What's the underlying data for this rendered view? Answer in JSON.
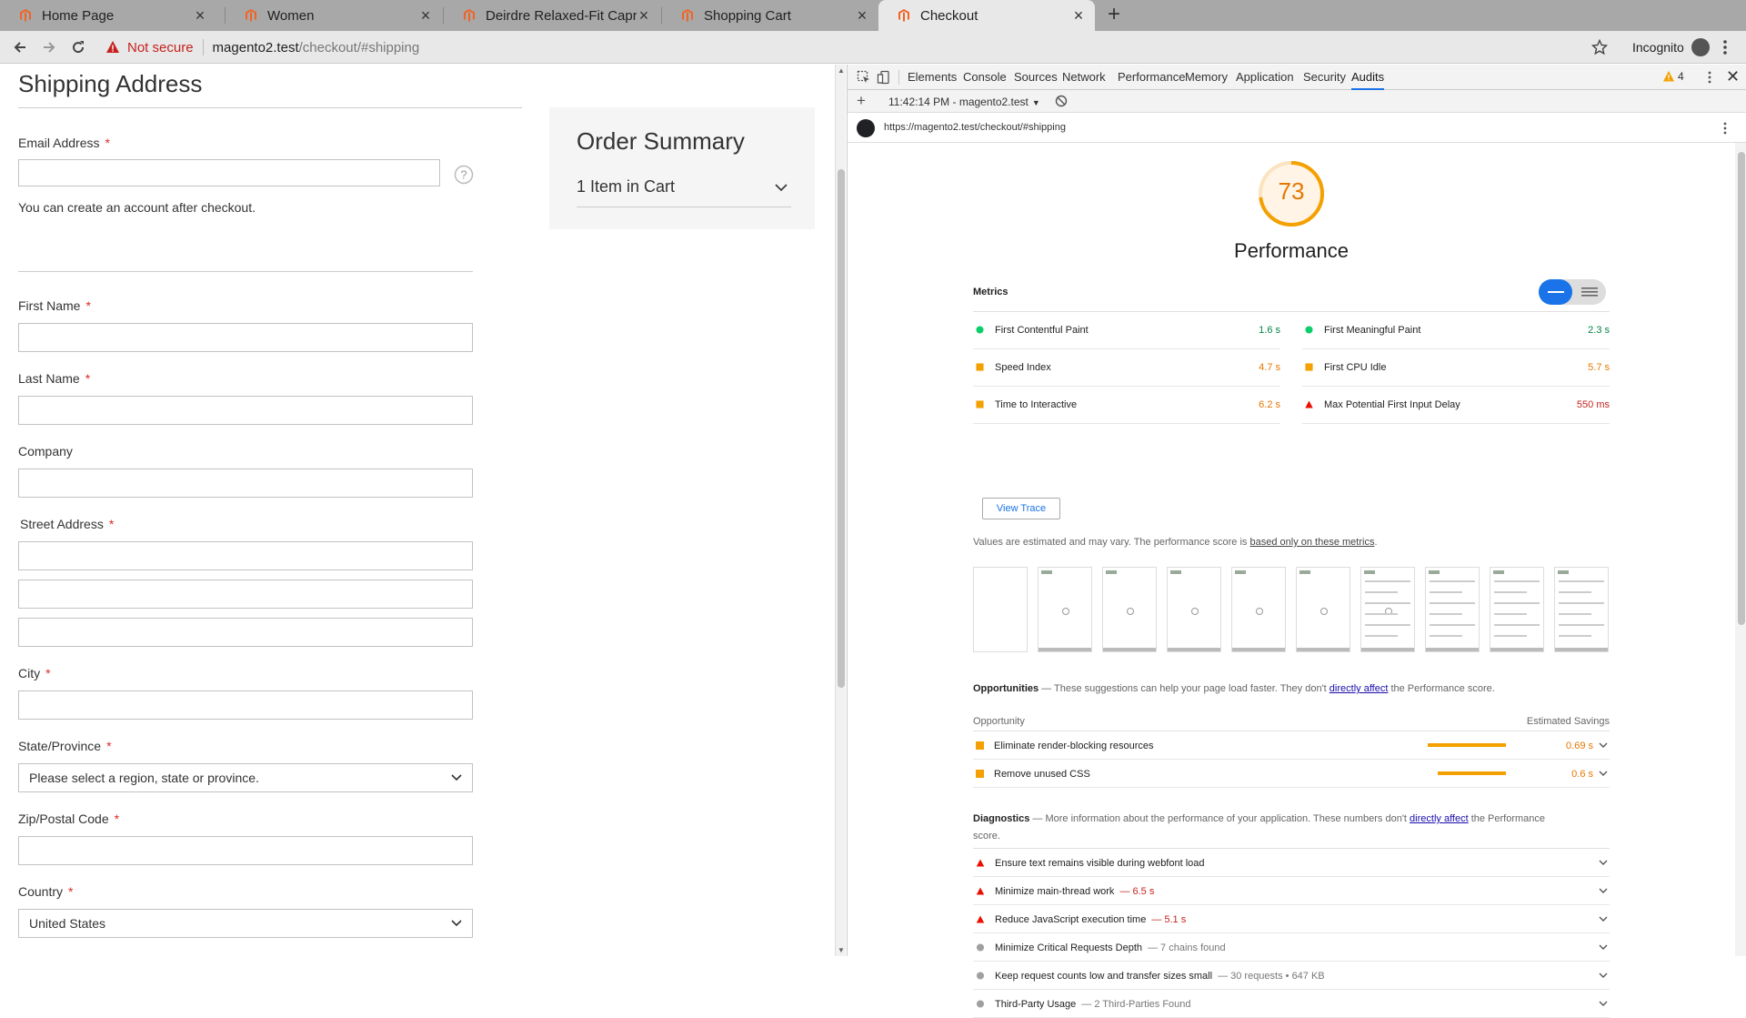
{
  "browser": {
    "tabs": [
      {
        "title": "Home Page"
      },
      {
        "title": "Women"
      },
      {
        "title": "Deirdre Relaxed-Fit Capri"
      },
      {
        "title": "Shopping Cart"
      },
      {
        "title": "Checkout",
        "active": true
      }
    ],
    "security_label": "Not secure",
    "url_host": "magento2.test",
    "url_path": "/checkout/#shipping",
    "profile_label": "Incognito"
  },
  "page": {
    "title": "Shipping Address",
    "email_label": "Email Address",
    "account_note": "You can create an account after checkout.",
    "first_name_label": "First Name",
    "last_name_label": "Last Name",
    "company_label": "Company",
    "street_label": "Street Address",
    "city_label": "City",
    "state_label": "State/Province",
    "state_value": "Please select a region, state or province.",
    "zip_label": "Zip/Postal Code",
    "country_label": "Country",
    "country_value": "United States",
    "required_mark": "*"
  },
  "order_summary": {
    "title": "Order Summary",
    "items": "1 Item in Cart"
  },
  "devtools": {
    "tabs": [
      "Elements",
      "Console",
      "Sources",
      "Network",
      "Performance",
      "Memory",
      "Application",
      "Security",
      "Audits"
    ],
    "active_tab": "Audits",
    "warning_count": "4",
    "report_label": "11:42:14 PM - magento2.test",
    "url": "https://magento2.test/checkout/#shipping"
  },
  "audit": {
    "score": "73",
    "score_value": 73,
    "category": "Performance",
    "metrics_heading": "Metrics",
    "metrics": [
      {
        "name": "First Contentful Paint",
        "value": "1.6 s",
        "status": "pass"
      },
      {
        "name": "First Meaningful Paint",
        "value": "2.3 s",
        "status": "pass"
      },
      {
        "name": "Speed Index",
        "value": "4.7 s",
        "status": "average"
      },
      {
        "name": "First CPU Idle",
        "value": "5.7 s",
        "status": "average"
      },
      {
        "name": "Time to Interactive",
        "value": "6.2 s",
        "status": "average"
      },
      {
        "name": "Max Potential First Input Delay",
        "value": "550 ms",
        "status": "fail"
      }
    ],
    "view_trace": "View Trace",
    "estimate_text": "Values are estimated and may vary. The performance score is ",
    "estimate_link": "based only on these metrics",
    "estimate_end": ".",
    "opportunities": {
      "heading": "Opportunities",
      "text": " — These suggestions can help your page load faster. They don't ",
      "link": "directly affect",
      "text_end": " the Performance score.",
      "col_left": "Opportunity",
      "col_right": "Estimated Savings",
      "items": [
        {
          "name": "Eliminate render-blocking resources",
          "value": "0.69 s",
          "savings": 0.69
        },
        {
          "name": "Remove unused CSS",
          "value": "0.6 s",
          "savings": 0.6
        }
      ]
    },
    "diagnostics": {
      "heading": "Diagnostics",
      "text": " — More information about the performance of your application. These numbers don't ",
      "link": "directly affect",
      "text_end": " the Performance score.",
      "items": [
        {
          "name": "Ensure text remains visible during webfont load",
          "detail": "",
          "status": "fail"
        },
        {
          "name": "Minimize main-thread work",
          "detail": "— 6.5 s",
          "status": "fail"
        },
        {
          "name": "Reduce JavaScript execution time",
          "detail": "— 5.1 s",
          "status": "fail"
        },
        {
          "name": "Minimize Critical Requests Depth",
          "detail": "— 7 chains found",
          "status": "info"
        },
        {
          "name": "Keep request counts low and transfer sizes small",
          "detail": "— 30 requests • 647 KB",
          "status": "info"
        },
        {
          "name": "Third-Party Usage",
          "detail": "— 2 Third-Parties Found",
          "status": "info"
        }
      ]
    }
  },
  "colors": {
    "pass": "#0cce6b",
    "average": "#f4a000",
    "fail": "#eb0f00",
    "info": "#a0a0a0",
    "accent": "#1a73e8",
    "magento": "#f26322"
  }
}
